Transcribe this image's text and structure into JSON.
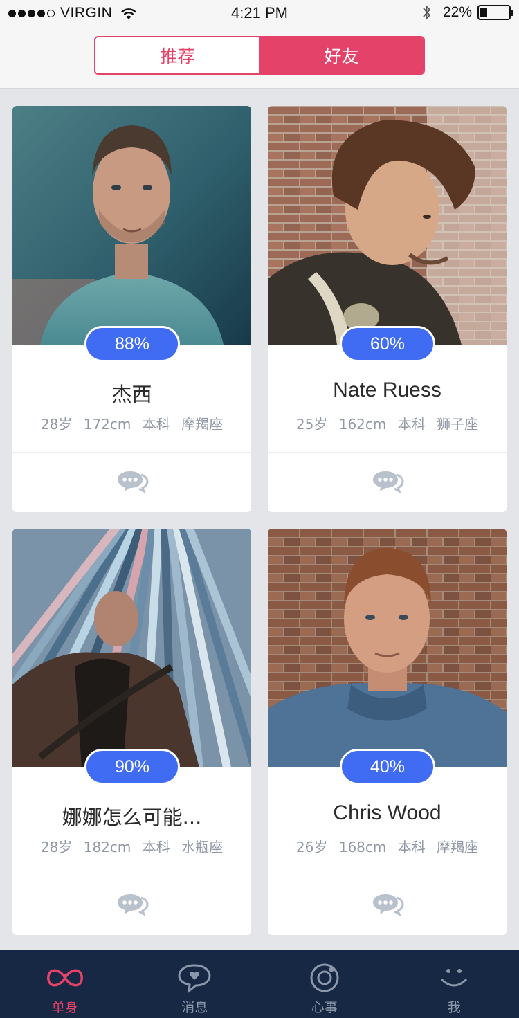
{
  "status_bar": {
    "carrier": "VIRGIN",
    "time": "4:21 PM",
    "battery": "22%",
    "icons": [
      "wifi-icon",
      "bluetooth-icon",
      "battery-icon"
    ]
  },
  "segments": [
    {
      "label": "推荐",
      "active": false
    },
    {
      "label": "好友",
      "active": true
    }
  ],
  "colors": {
    "accent": "#e5426a",
    "badge": "#3f6cf3",
    "tabbar": "#162843"
  },
  "cards": [
    {
      "match": "88%",
      "name": "杰西",
      "age": "28岁",
      "height": "172cm",
      "education": "本科",
      "sign": "摩羯座"
    },
    {
      "match": "60%",
      "name": "Nate Ruess",
      "age": "25岁",
      "height": "162cm",
      "education": "本科",
      "sign": "狮子座"
    },
    {
      "match": "90%",
      "name": "娜娜怎么可能...",
      "age": "28岁",
      "height": "182cm",
      "education": "本科",
      "sign": "水瓶座"
    },
    {
      "match": "40%",
      "name": "Chris Wood",
      "age": "26岁",
      "height": "168cm",
      "education": "本科",
      "sign": "摩羯座"
    }
  ],
  "tabbar": [
    {
      "label": "单身",
      "icon": "infinity-icon",
      "active": true
    },
    {
      "label": "消息",
      "icon": "message-heart-icon",
      "active": false
    },
    {
      "label": "心事",
      "icon": "circle-icon",
      "active": false
    },
    {
      "label": "我",
      "icon": "smile-icon",
      "active": false
    }
  ]
}
